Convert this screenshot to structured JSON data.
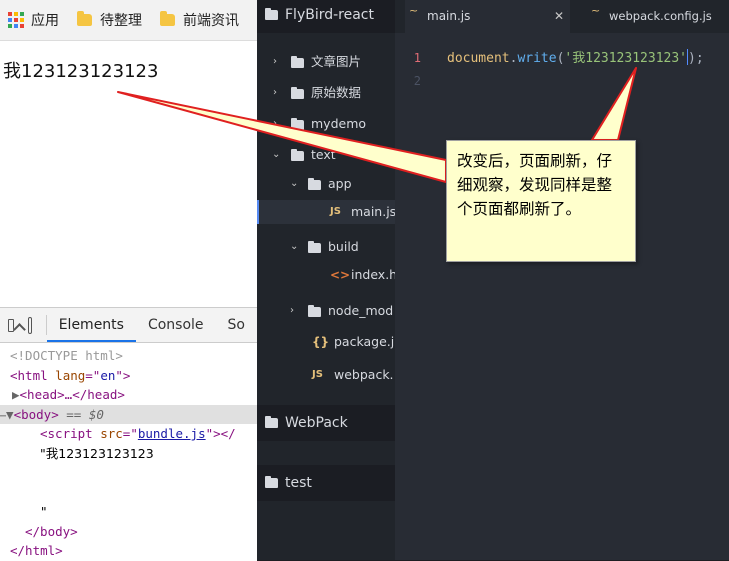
{
  "browser": {
    "bookmarks": [
      {
        "label": "应用",
        "icon": "apps-grid-icon"
      },
      {
        "label": "待整理",
        "icon": "folder-icon"
      },
      {
        "label": "前端资讯",
        "icon": "folder-icon"
      }
    ],
    "page_text": "我123123123123"
  },
  "devtools": {
    "tabs": [
      "Elements",
      "Console",
      "So"
    ],
    "active_tab": "Elements",
    "dom": {
      "doctype": "<!DOCTYPE html>",
      "html_tag": "html",
      "lang_attr": "lang",
      "lang_val": "en",
      "head_collapsed": "<head>…</head>",
      "body_tag": "body",
      "selected_marker": "== $0",
      "script_tag": "script",
      "script_attr": "src",
      "script_src": "bundle.js",
      "text_node": "\"我123123123123",
      "text_close": "\"",
      "body_close": "</body>",
      "html_close": "</html>"
    }
  },
  "editor": {
    "project_name": "FlyBird-react",
    "tree": [
      {
        "label": "文章图片",
        "type": "folder",
        "expanded": false
      },
      {
        "label": "原始数据",
        "type": "folder",
        "expanded": false
      },
      {
        "label": "mydemo",
        "type": "folder",
        "expanded": false
      },
      {
        "label": "text",
        "type": "folder",
        "expanded": true
      },
      {
        "label": "app",
        "type": "folder",
        "expanded": true
      },
      {
        "label": "main.js",
        "type": "js"
      },
      {
        "label": "build",
        "type": "folder",
        "expanded": true
      },
      {
        "label": "index.h",
        "type": "html"
      },
      {
        "label": "node_mod",
        "type": "folder",
        "expanded": false
      },
      {
        "label": "package.j",
        "type": "json"
      },
      {
        "label": "webpack.",
        "type": "js"
      }
    ],
    "other_projects": [
      "WebPack",
      "test"
    ],
    "tabs": [
      {
        "label": "main.js",
        "active": true,
        "icon": "js-file-icon"
      },
      {
        "label": "webpack.config.js",
        "active": false,
        "icon": "js-file-icon"
      }
    ],
    "line_numbers": [
      "1",
      "2"
    ],
    "code": {
      "object": "document",
      "dot": ".",
      "method": "write",
      "open": "(",
      "string": "'我123123123123'",
      "close": ");"
    }
  },
  "callout": {
    "text": "改变后，页面刷新，仔细观察，发现同样是整个页面都刷新了。",
    "background": "#ffffcc",
    "arrow_color": "#e02020"
  }
}
